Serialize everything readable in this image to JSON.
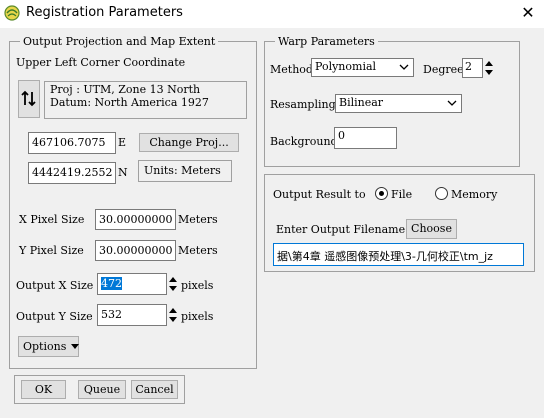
{
  "window": {
    "title": "Registration Parameters",
    "close_glyph": "✕"
  },
  "output_projection": {
    "legend": "Output Projection and Map Extent",
    "upper_left_label": "Upper Left Corner Coordinate",
    "proj_line": "Proj : UTM, Zone 13 North",
    "datum_line": "Datum: North America 1927",
    "easting_value": "467106.7075",
    "easting_unit": "E",
    "northing_value": "4442419.2552",
    "northing_unit": "N",
    "change_proj_label": "Change Proj...",
    "units_text": "Units: Meters",
    "x_pixel_size_label": "X Pixel Size",
    "x_pixel_size_value": "30.00000000",
    "x_pixel_size_unit": "Meters",
    "y_pixel_size_label": "Y Pixel Size",
    "y_pixel_size_value": "30.00000000",
    "y_pixel_size_unit": "Meters",
    "output_x_size_label": "Output X Size",
    "output_x_size_value": "472",
    "output_x_size_unit": "pixels",
    "output_y_size_label": "Output Y Size",
    "output_y_size_value": "532",
    "output_y_size_unit": "pixels",
    "options_label": "Options"
  },
  "warp": {
    "legend": "Warp Parameters",
    "method_label": "Method",
    "method_value": "Polynomial",
    "degree_label": "Degree",
    "degree_value": "2",
    "resampling_label": "Resampling",
    "resampling_value": "Bilinear",
    "background_label": "Background",
    "background_value": "0"
  },
  "output": {
    "result_to_label": "Output Result to",
    "file_label": "File",
    "memory_label": "Memory",
    "selected": "File",
    "filename_label": "Enter Output Filename",
    "choose_label": "Choose",
    "filename_value": "据\\第4章 遥感图像预处理\\3-几何校正\\tm_jz"
  },
  "footer": {
    "ok_label": "OK",
    "queue_label": "Queue",
    "cancel_label": "Cancel"
  }
}
